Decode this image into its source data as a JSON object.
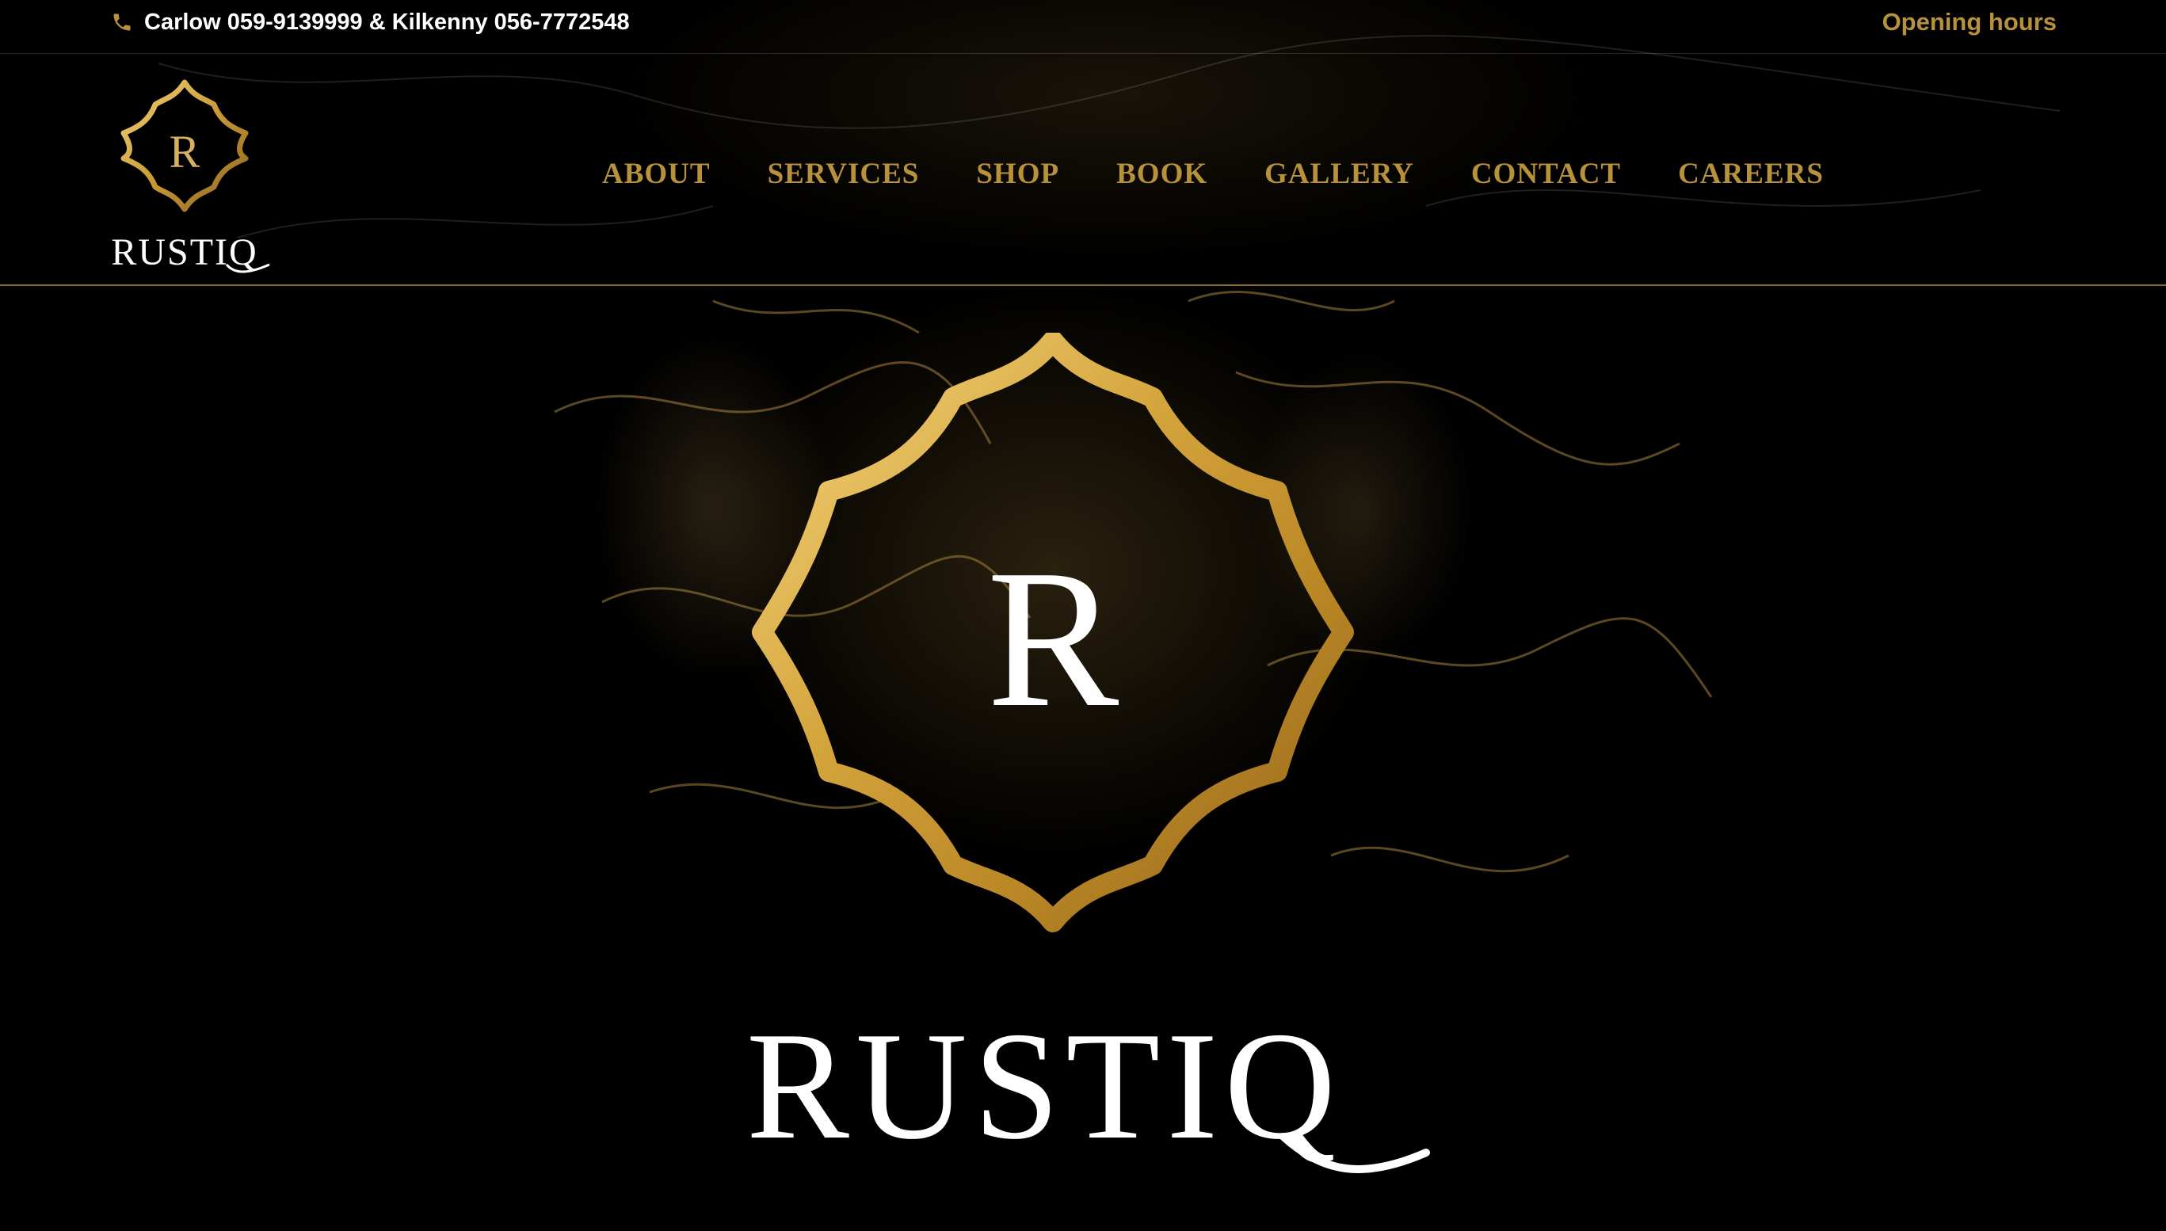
{
  "topbar": {
    "contact_text": "Carlow  059-9139999 & Kilkenny  056-7772548",
    "opening_hours": "Opening hours",
    "phone_icon": "phone-icon"
  },
  "brand": {
    "name": "RUSTIQ",
    "monogram": "R"
  },
  "nav": {
    "items": [
      "ABOUT",
      "SERVICES",
      "SHOP",
      "BOOK",
      "GALLERY",
      "CONTACT",
      "CAREERS"
    ]
  },
  "colors": {
    "gold": "#b8923a",
    "background": "#000000",
    "text": "#ffffff"
  }
}
